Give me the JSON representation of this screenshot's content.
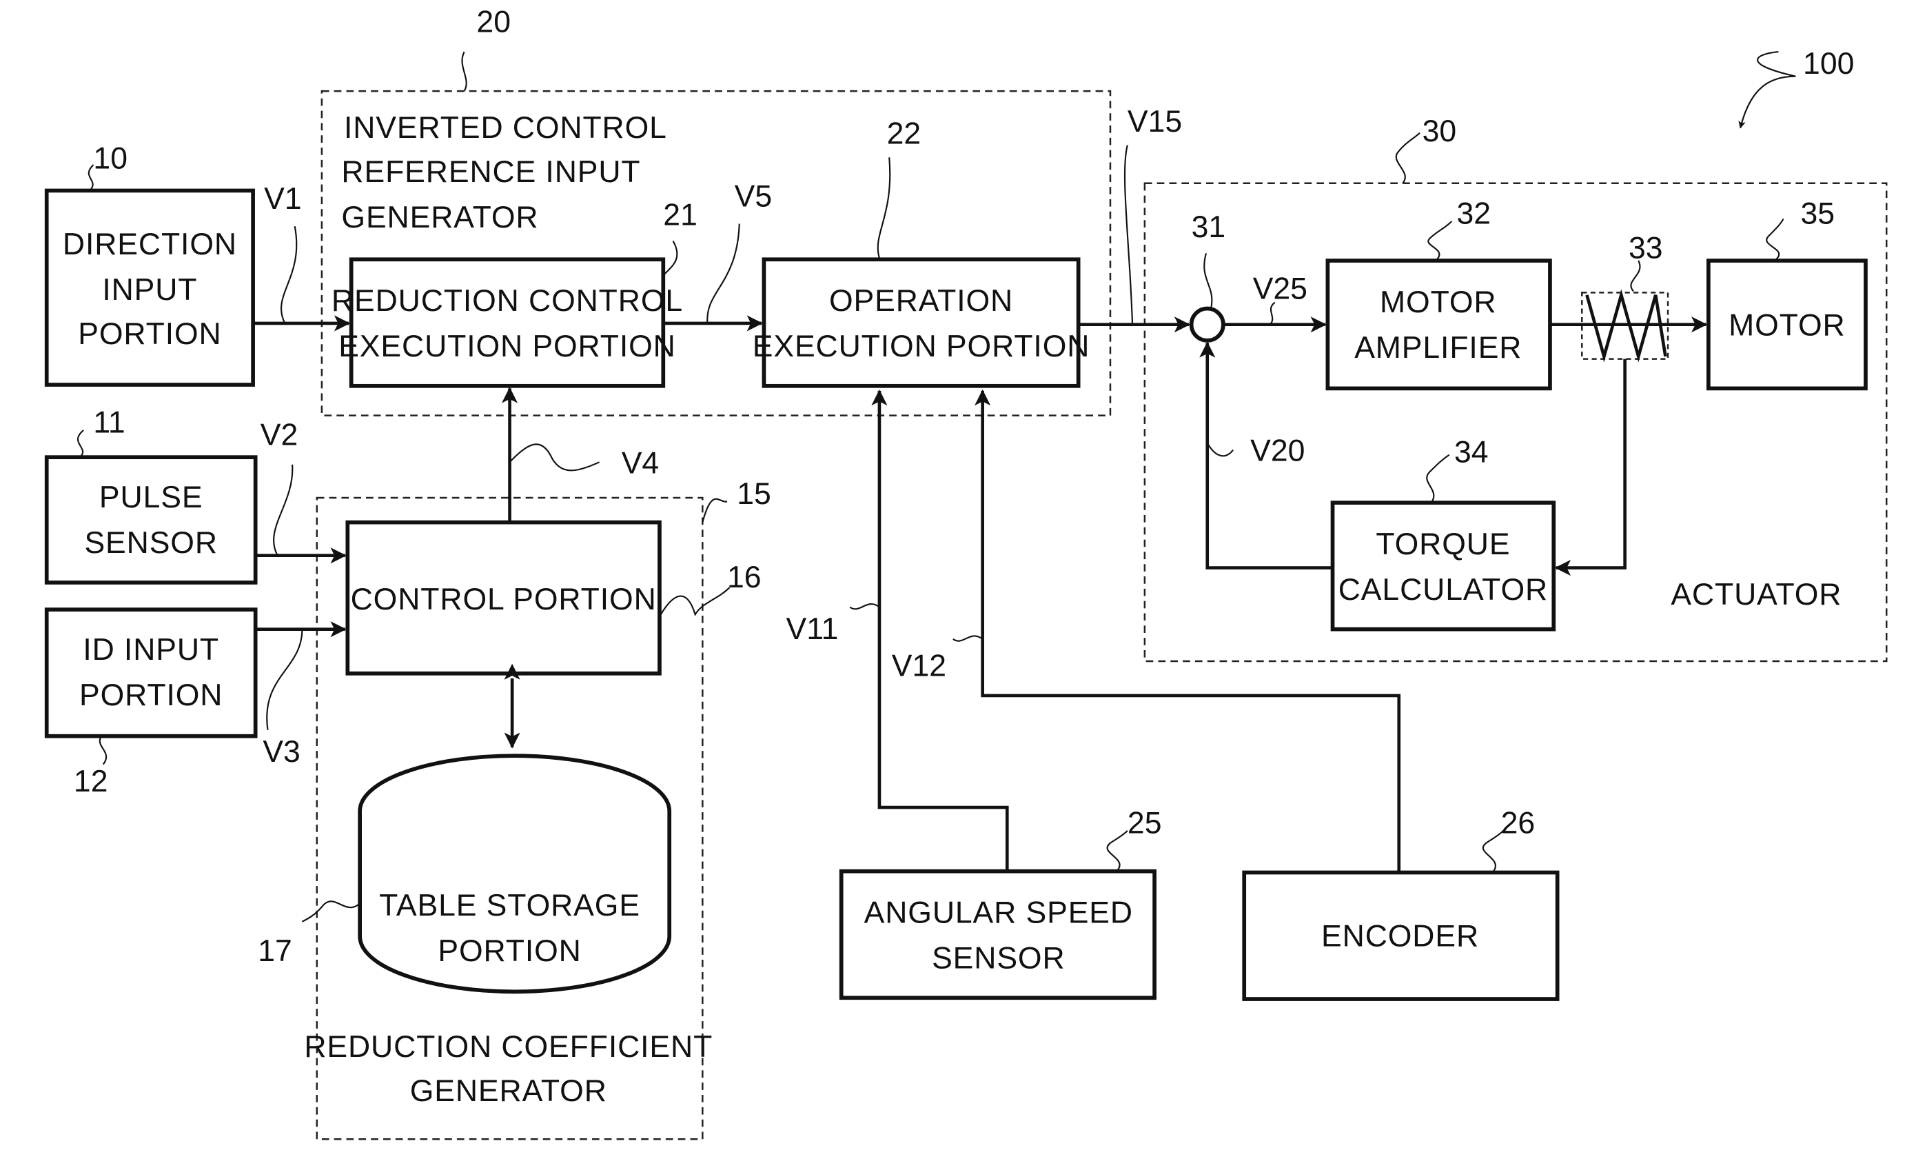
{
  "figure": {
    "reference_numeral": "100",
    "groups": {
      "inverted_control": {
        "numeral": "20",
        "label_lines": [
          "INVERTED CONTROL",
          "REFERENCE INPUT",
          "GENERATOR"
        ]
      },
      "reduction_coefficient": {
        "numeral": "15",
        "label_lines": [
          "REDUCTION COEFFICIENT",
          "GENERATOR"
        ]
      },
      "actuator": {
        "numeral": "30",
        "label_lines": [
          "ACTUATOR"
        ]
      }
    },
    "blocks": {
      "direction_input": {
        "numeral": "10",
        "label_lines": [
          "DIRECTION",
          "INPUT",
          "PORTION"
        ]
      },
      "pulse_sensor": {
        "numeral": "11",
        "label_lines": [
          "PULSE",
          "SENSOR"
        ]
      },
      "id_input": {
        "numeral": "12",
        "label_lines": [
          "ID INPUT",
          "PORTION"
        ]
      },
      "control_portion": {
        "numeral": "16",
        "label_lines": [
          "CONTROL PORTION"
        ]
      },
      "table_storage": {
        "numeral": "17",
        "label_lines": [
          "TABLE STORAGE",
          "PORTION"
        ]
      },
      "reduction_control": {
        "numeral": "21",
        "label_lines": [
          "REDUCTION CONTROL",
          "EXECUTION PORTION"
        ]
      },
      "operation_execution": {
        "numeral": "22",
        "label_lines": [
          "OPERATION",
          "EXECUTION PORTION"
        ]
      },
      "angular_speed_sensor": {
        "numeral": "25",
        "label_lines": [
          "ANGULAR SPEED",
          "SENSOR"
        ]
      },
      "encoder": {
        "numeral": "26",
        "label_lines": [
          "ENCODER"
        ]
      },
      "summing_junction": {
        "numeral": "31"
      },
      "motor_amplifier": {
        "numeral": "32",
        "label_lines": [
          "MOTOR",
          "AMPLIFIER"
        ]
      },
      "spring": {
        "numeral": "33"
      },
      "torque_calculator": {
        "numeral": "34",
        "label_lines": [
          "TORQUE",
          "CALCULATOR"
        ]
      },
      "motor": {
        "numeral": "35",
        "label_lines": [
          "MOTOR"
        ]
      }
    },
    "signals": {
      "v1": "V1",
      "v2": "V2",
      "v3": "V3",
      "v4": "V4",
      "v5": "V5",
      "v11": "V11",
      "v12": "V12",
      "v15": "V15",
      "v20": "V20",
      "v25": "V25"
    }
  }
}
